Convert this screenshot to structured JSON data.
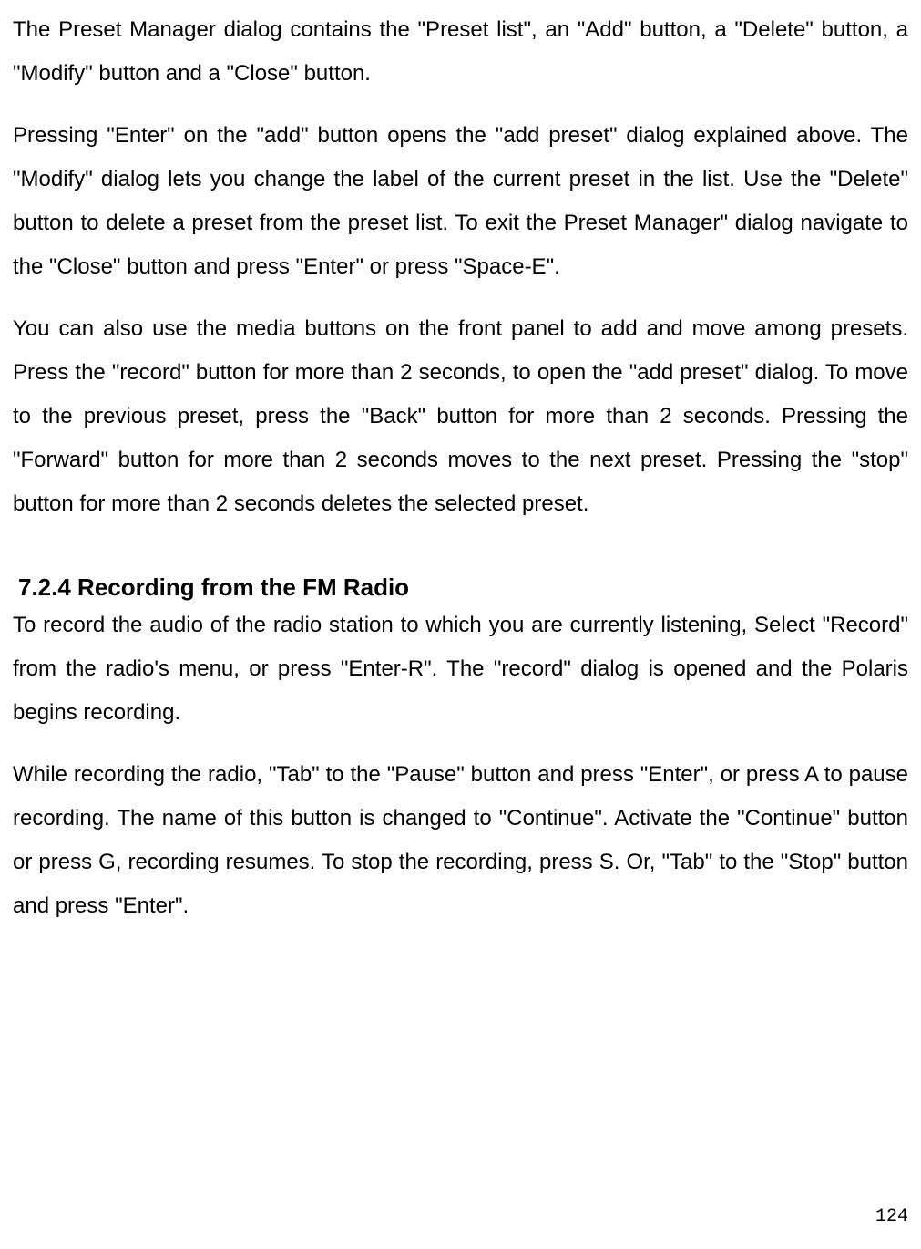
{
  "paragraphs": {
    "p1": "The Preset Manager dialog contains the \"Preset list\", an \"Add\" button, a \"Delete\" button, a \"Modify\" button and a \"Close\" button.",
    "p2": "Pressing \"Enter\" on the \"add\" button opens the \"add preset\" dialog explained above. The \"Modify\" dialog lets you change the label of the current preset in the list. Use the \"Delete\" button to delete a preset from the preset list. To exit the Preset Manager\" dialog navigate to the \"Close\" button and press \"Enter\" or press \"Space-E\".",
    "p3": "You can also use the media buttons on the front panel to add and move among presets. Press the \"record\" button for more than 2 seconds, to open the \"add preset\" dialog. To move to the previous preset, press the \"Back\" button for more than 2 seconds. Pressing the \"Forward\" button for more than 2 seconds moves to the next preset. Pressing the \"stop\" button for more than 2 seconds deletes the selected preset.",
    "p4": "To record the audio of the radio station to which you are currently listening, Select \"Record\" from the radio's menu, or press \"Enter-R\". The \"record\" dialog is opened and the Polaris begins recording.",
    "p5": "While recording the radio, \"Tab\" to the \"Pause\" button and press \"Enter\", or press A to pause recording. The name of this button is changed to \"Continue\". Activate the \"Continue\" button or press G, recording resumes. To stop the recording, press S. Or, \"Tab\" to the \"Stop\" button and press \"Enter\"."
  },
  "heading": "7.2.4 Recording from the FM Radio",
  "page_number": "124"
}
